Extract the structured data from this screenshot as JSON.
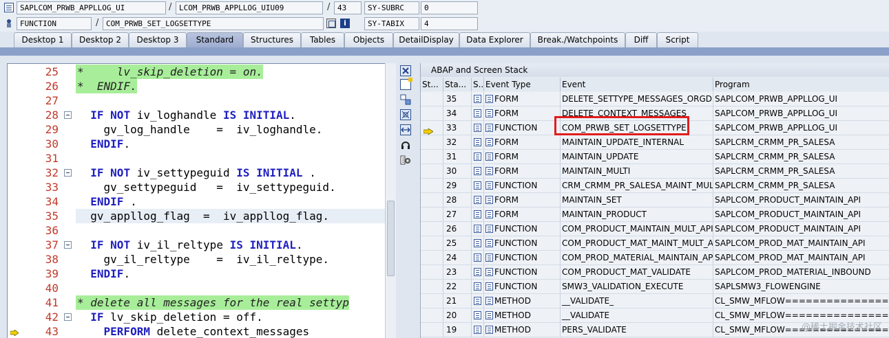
{
  "header": {
    "row1": {
      "program": "SAPLCOM_PRWB_APPLLOG_UI",
      "include": "LCOM_PRWB_APPLLOG_UIU09",
      "line": "43",
      "sysfield_label": "SY-SUBRC",
      "sysfield_value": "0"
    },
    "row2": {
      "event_type": "FUNCTION",
      "event": "COM_PRWB_SET_LOGSETTYPE",
      "sysfield_label": "SY-TABIX",
      "sysfield_value": "4"
    }
  },
  "tabs": [
    "Desktop 1",
    "Desktop 2",
    "Desktop 3",
    "Standard",
    "Structures",
    "Tables",
    "Objects",
    "DetailDisplay",
    "Data Explorer",
    "Break./Watchpoints",
    "Diff",
    "Script"
  ],
  "active_tab": "Standard",
  "editor": {
    "lines": [
      {
        "num": "25",
        "text": "*     lv_skip_deletion = on.",
        "style": "comment"
      },
      {
        "num": "26",
        "text": "*  ENDIF.",
        "style": "comment"
      },
      {
        "num": "27",
        "text": "",
        "style": ""
      },
      {
        "num": "28",
        "text": "  IF NOT iv_loghandle IS INITIAL.",
        "style": ""
      },
      {
        "num": "29",
        "text": "    gv_log_handle    =  iv_loghandle.",
        "style": ""
      },
      {
        "num": "30",
        "text": "  ENDIF.",
        "style": ""
      },
      {
        "num": "31",
        "text": "",
        "style": ""
      },
      {
        "num": "32",
        "text": "  IF NOT iv_settypeguid IS INITIAL .",
        "style": ""
      },
      {
        "num": "33",
        "text": "    gv_settypeguid   =  iv_settypeguid.",
        "style": ""
      },
      {
        "num": "34",
        "text": "  ENDIF .",
        "style": ""
      },
      {
        "num": "35",
        "text": "  gv_appllog_flag  =  iv_appllog_flag.",
        "style": "hl"
      },
      {
        "num": "36",
        "text": "",
        "style": ""
      },
      {
        "num": "37",
        "text": "  IF NOT iv_il_reltype IS INITIAL.",
        "style": ""
      },
      {
        "num": "38",
        "text": "    gv_il_reltype    =  iv_il_reltype.",
        "style": ""
      },
      {
        "num": "39",
        "text": "  ENDIF.",
        "style": ""
      },
      {
        "num": "40",
        "text": "",
        "style": ""
      },
      {
        "num": "41",
        "text": "* delete all messages for the real settyp",
        "style": "comment"
      },
      {
        "num": "42",
        "text": "  IF lv_skip_deletion = off.",
        "style": ""
      },
      {
        "num": "43",
        "text": "    PERFORM delete_context_messages",
        "style": ""
      }
    ],
    "keywords": [
      "IF",
      "NOT",
      "IS",
      "INITIAL",
      "ENDIF",
      "PERFORM"
    ]
  },
  "stack": {
    "title": "ABAP and Screen Stack",
    "columns": [
      "St...",
      "Sta...",
      "S..",
      "Event Type",
      "Event",
      "Program"
    ],
    "rows": [
      {
        "level": "35",
        "type": "FORM",
        "event": "DELETE_SETTYPE_MESSAGES_ORGDE...",
        "program": "SAPLCOM_PRWB_APPLLOG_UI"
      },
      {
        "level": "34",
        "type": "FORM",
        "event": "DELETE_CONTEXT_MESSAGES",
        "program": "SAPLCOM_PRWB_APPLLOG_UI"
      },
      {
        "level": "33",
        "type": "FUNCTION",
        "event": "COM_PRWB_SET_LOGSETTYPE",
        "program": "SAPLCOM_PRWB_APPLLOG_UI",
        "current": true
      },
      {
        "level": "32",
        "type": "FORM",
        "event": "MAINTAIN_UPDATE_INTERNAL",
        "program": "SAPLCRM_CRMM_PR_SALESA"
      },
      {
        "level": "31",
        "type": "FORM",
        "event": "MAINTAIN_UPDATE",
        "program": "SAPLCRM_CRMM_PR_SALESA"
      },
      {
        "level": "30",
        "type": "FORM",
        "event": "MAINTAIN_MULTI",
        "program": "SAPLCRM_CRMM_PR_SALESA"
      },
      {
        "level": "29",
        "type": "FUNCTION",
        "event": "CRM_CRMM_PR_SALESA_MAINT_MUL",
        "program": "SAPLCRM_CRMM_PR_SALESA"
      },
      {
        "level": "28",
        "type": "FORM",
        "event": "MAINTAIN_SET",
        "program": "SAPLCOM_PRODUCT_MAINTAIN_API"
      },
      {
        "level": "27",
        "type": "FORM",
        "event": "MAINTAIN_PRODUCT",
        "program": "SAPLCOM_PRODUCT_MAINTAIN_API"
      },
      {
        "level": "26",
        "type": "FUNCTION",
        "event": "COM_PRODUCT_MAINTAIN_MULT_API",
        "program": "SAPLCOM_PRODUCT_MAINTAIN_API"
      },
      {
        "level": "25",
        "type": "FUNCTION",
        "event": "COM_PRODUCT_MAT_MAINT_MULT_A...",
        "program": "SAPLCOM_PROD_MAT_MAINTAIN_API"
      },
      {
        "level": "24",
        "type": "FUNCTION",
        "event": "COM_PROD_MATERIAL_MAINTAIN_API",
        "program": "SAPLCOM_PROD_MAT_MAINTAIN_API"
      },
      {
        "level": "23",
        "type": "FUNCTION",
        "event": "COM_PRODUCT_MAT_VALIDATE",
        "program": "SAPLCOM_PROD_MATERIAL_INBOUND"
      },
      {
        "level": "22",
        "type": "FUNCTION",
        "event": "SMW3_VALIDATION_EXECUTE",
        "program": "SAPLSMW3_FLOWENGINE"
      },
      {
        "level": "21",
        "type": "METHOD",
        "event": "__VALIDATE_",
        "program": "CL_SMW_MFLOW================="
      },
      {
        "level": "20",
        "type": "METHOD",
        "event": "__VALIDATE",
        "program": "CL_SMW_MFLOW================="
      },
      {
        "level": "19",
        "type": "METHOD",
        "event": "PERS_VALIDATE",
        "program": "CL_SMW_MFLOW================="
      }
    ]
  },
  "watermark": "@稀土掘金技术社区",
  "colors": {
    "accent": "#8aa0c8",
    "highlight_box": "#e11c1c",
    "comment_bg": "#a8ee9a",
    "keyword": "#1f1fbf",
    "line_number": "#c0392b"
  }
}
